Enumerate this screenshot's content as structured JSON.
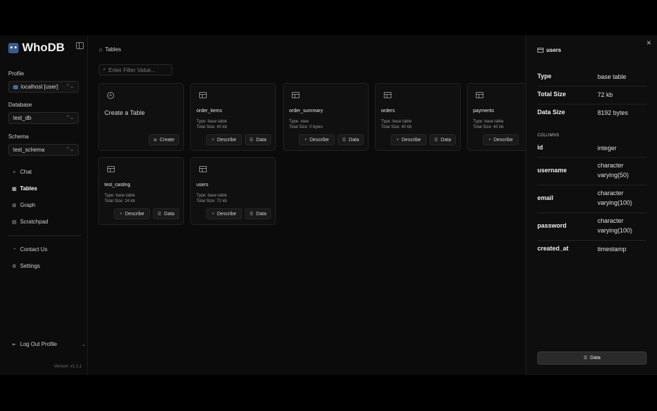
{
  "app": {
    "name": "WhoDB",
    "version": "Version: v1.1.1"
  },
  "sidebar": {
    "profile_label": "Profile",
    "profile_value": "localhost [user]",
    "database_label": "Database",
    "database_value": "test_db",
    "schema_label": "Schema",
    "schema_value": "test_schema",
    "nav": [
      {
        "label": "Chat",
        "icon": "sparkle-icon"
      },
      {
        "label": "Tables",
        "icon": "table-icon",
        "active": true
      },
      {
        "label": "Graph",
        "icon": "graph-icon"
      },
      {
        "label": "Scratchpad",
        "icon": "scratchpad-icon"
      }
    ],
    "contact": "Contact Us",
    "settings": "Settings",
    "logout": "Log Out Profile"
  },
  "main": {
    "breadcrumb": "Tables",
    "filter_placeholder": "Enter Filter Value...",
    "create_card": {
      "title": "Create a Table",
      "button": "Create"
    },
    "describe_label": "Describe",
    "data_label": "Data",
    "tables": [
      {
        "name": "order_items",
        "type": "Type: base table",
        "size": "Total Size: 40 kb"
      },
      {
        "name": "order_summary",
        "type": "Type: view",
        "size": "Total Size: 0 bytes"
      },
      {
        "name": "orders",
        "type": "Type: base table",
        "size": "Total Size: 40 kb"
      },
      {
        "name": "payments",
        "type": "Type: base table",
        "size": "Total Size: 40 kb"
      },
      {
        "name": "test_casting",
        "type": "Type: base table",
        "size": "Total Size: 24 kb"
      },
      {
        "name": "users",
        "type": "Type: base table",
        "size": "Total Size: 72 kb"
      }
    ]
  },
  "panel": {
    "title": "users",
    "rows": [
      {
        "k": "Type",
        "v": "base table"
      },
      {
        "k": "Total Size",
        "v": "72 kb"
      },
      {
        "k": "Data Size",
        "v": "8192 bytes"
      }
    ],
    "columns_label": "COLUMNS",
    "columns": [
      {
        "k": "id",
        "v": "integer"
      },
      {
        "k": "username",
        "v": "character varying(50)"
      },
      {
        "k": "email",
        "v": "character varying(100)"
      },
      {
        "k": "password",
        "v": "character varying(100)"
      },
      {
        "k": "created_at",
        "v": "timestamp"
      }
    ],
    "data_button": "Data"
  }
}
